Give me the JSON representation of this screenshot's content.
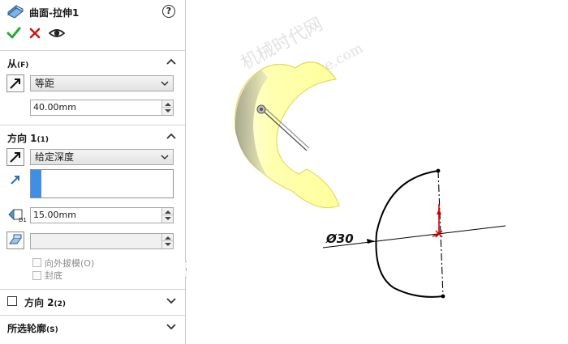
{
  "panel": {
    "title": "曲面-拉伸1",
    "help_label": "?",
    "from": {
      "title": "从",
      "shortcut": "(F)",
      "condition": "等距",
      "offset_value": "40.00mm"
    },
    "direction1": {
      "title": "方向 1",
      "shortcut": "(1)",
      "end_condition": "给定深度",
      "depth_value": "15.00mm",
      "draft_value": "",
      "draft_outward_label": "向外拔模(O)",
      "cap_end_label": "封底"
    },
    "direction2": {
      "title": "方向 2",
      "shortcut": "(2)"
    },
    "selected_contours": {
      "title": "所选轮廓",
      "shortcut": "(S)"
    }
  },
  "viewport": {
    "watermark_line1": "机械时代网",
    "watermark_line2": "www.jxage.com",
    "dimension_label": "Ø30"
  },
  "colors": {
    "surface_fill": "#ffffa6",
    "surface_edge": "#e8e36a",
    "sketch_red": "#d10000",
    "accept_green": "#2aa832",
    "cancel_red": "#d11414",
    "list_selection_blue": "#3f8fe6"
  }
}
